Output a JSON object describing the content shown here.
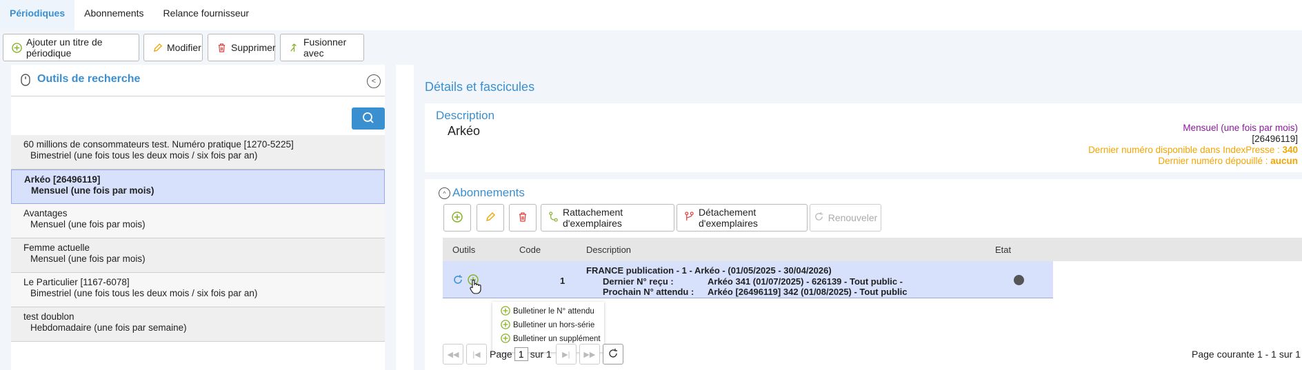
{
  "tabs": [
    {
      "label": "Périodiques"
    },
    {
      "label": "Abonnements"
    },
    {
      "label": "Relance fournisseur"
    }
  ],
  "toolbar": {
    "add_label": "Ajouter un titre de périodique",
    "edit_label": "Modifier",
    "delete_label": "Supprimer",
    "merge_label": "Fusionner avec"
  },
  "search_panel": {
    "title": "Outils de recherche",
    "items": [
      {
        "title": "60 millions de consommateurs test. Numéro pratique  [1270-5225]",
        "freq": "Bimestriel (une fois tous les deux mois / six fois par an)"
      },
      {
        "title": "Arkéo  [26496119]",
        "freq": "Mensuel (une fois par mois)"
      },
      {
        "title": "Avantages",
        "freq": "Mensuel (une fois par mois)"
      },
      {
        "title": "Femme actuelle",
        "freq": "Mensuel (une fois par mois)"
      },
      {
        "title": "Le Particulier  [1167-6078]",
        "freq": "Bimestriel (une fois tous les deux mois / six fois par an)"
      },
      {
        "title": "test doublon",
        "freq": "Hebdomadaire (une fois par semaine)"
      }
    ]
  },
  "details": {
    "title": "Détails et fascicules",
    "description": {
      "title": "Description",
      "name": "Arkéo",
      "periodicity": "Mensuel (une fois par mois)",
      "issn": "[26496119]",
      "last_available_label": "Dernier numéro disponible dans IndexPresse : ",
      "last_available_value": "340",
      "last_processed_label": "Dernier numéro dépouillé : ",
      "last_processed_value": "aucun"
    }
  },
  "subscriptions": {
    "title": "Abonnements",
    "attach_label": "Rattachement d'exemplaires",
    "detach_label": "Détachement d'exemplaires",
    "renew_label": "Renouveler",
    "columns": {
      "tools": "Outils",
      "code": "Code",
      "description": "Description",
      "state": "Etat"
    },
    "row": {
      "code": "1",
      "line1": "FRANCE  publication - 1 - Arkéo - (01/05/2025 - 30/04/2026)",
      "last_key": "Dernier N° reçu :",
      "last_val": "Arkéo 341 (01/07/2025) - 626139 - Tout public -",
      "next_key": "Prochain N° attendu :",
      "next_val": "Arkéo [26496119] 342 (01/08/2025) - Tout public"
    },
    "menu": [
      {
        "label": "Bulletiner le N° attendu"
      },
      {
        "label": "Bulletiner un hors-série"
      },
      {
        "label": "Bulletiner un supplément"
      }
    ]
  },
  "pager": {
    "page_label": "Page",
    "page_value": "1",
    "of_label": "sur 1",
    "info": "Page courante 1 - 1 sur 1"
  },
  "colors": {
    "accent": "#3a8fd0",
    "selected": "#d8e1fc",
    "orange": "#f2a400",
    "purple": "#8a1a9a"
  }
}
